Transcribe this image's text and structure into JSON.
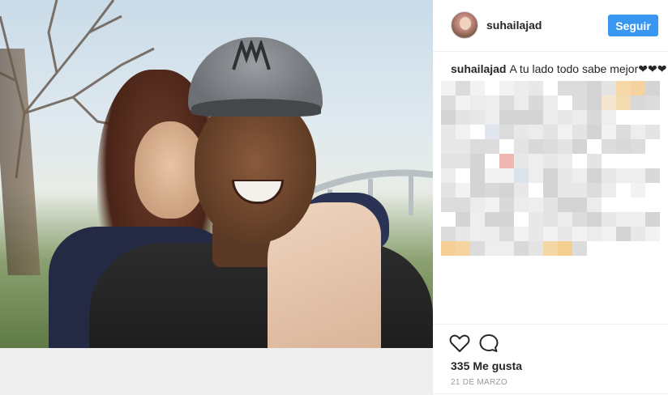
{
  "post": {
    "image_alt": "Selfie of a couple outdoors",
    "author": {
      "username": "suhailajad",
      "avatar_icon": "profile-avatar"
    },
    "follow_button_label": "Seguir",
    "caption": {
      "username": "suhailajad",
      "text": "A tu lado todo sabe mejor❤❤❤"
    },
    "likes": {
      "count": "335",
      "label": "Me gusta"
    },
    "date": "21 DE MARZO"
  },
  "colors": {
    "accent": "#3897f0",
    "text": "#262626",
    "muted": "#999999",
    "divider": "#efefef"
  },
  "icons": {
    "like": "heart-icon",
    "comment": "comment-icon"
  }
}
